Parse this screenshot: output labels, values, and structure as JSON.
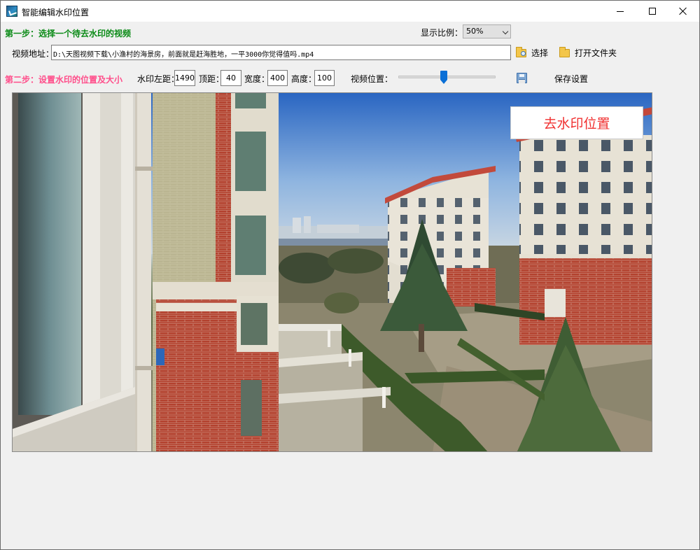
{
  "window": {
    "title": "智能编辑水印位置"
  },
  "step1": {
    "label": "第一步：选择一个待去水印的视频",
    "ratio_label": "显示比例：",
    "ratio_value": "50%",
    "path_label": "视频地址：",
    "path_value": "D:\\天图视频下载\\小渔村的海景房，前面就是赶海胜地，一平3000你觉得值吗.mp4",
    "select_label": "选择",
    "open_folder_label": "打开文件夹"
  },
  "step2": {
    "label": "第二步：设置水印的位置及大小",
    "left_label": "水印左距：",
    "left_value": "1490",
    "top_label": "顶距：",
    "top_value": "40",
    "width_label": "宽度：",
    "width_value": "400",
    "height_label": "高度：",
    "height_value": "100",
    "position_label": "视频位置：",
    "position_fraction": 0.47,
    "save_label": "保存设置"
  },
  "preview": {
    "watermark_label": "去水印位置"
  },
  "colors": {
    "step1": "#0a8a16",
    "step2": "#ff4d8a",
    "watermark_text": "#f03030",
    "slider": "#0a6fd6"
  }
}
